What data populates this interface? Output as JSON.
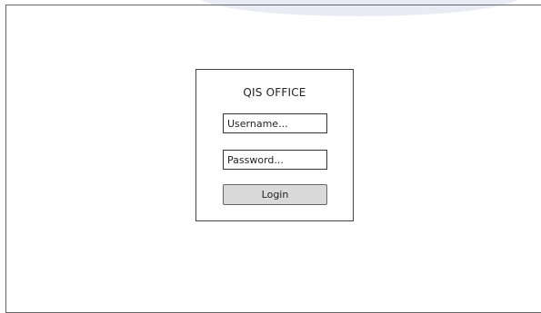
{
  "login": {
    "title": "QIS OFFICE",
    "username_placeholder": "Username...",
    "password_placeholder": "Password...",
    "login_button": "Login"
  }
}
